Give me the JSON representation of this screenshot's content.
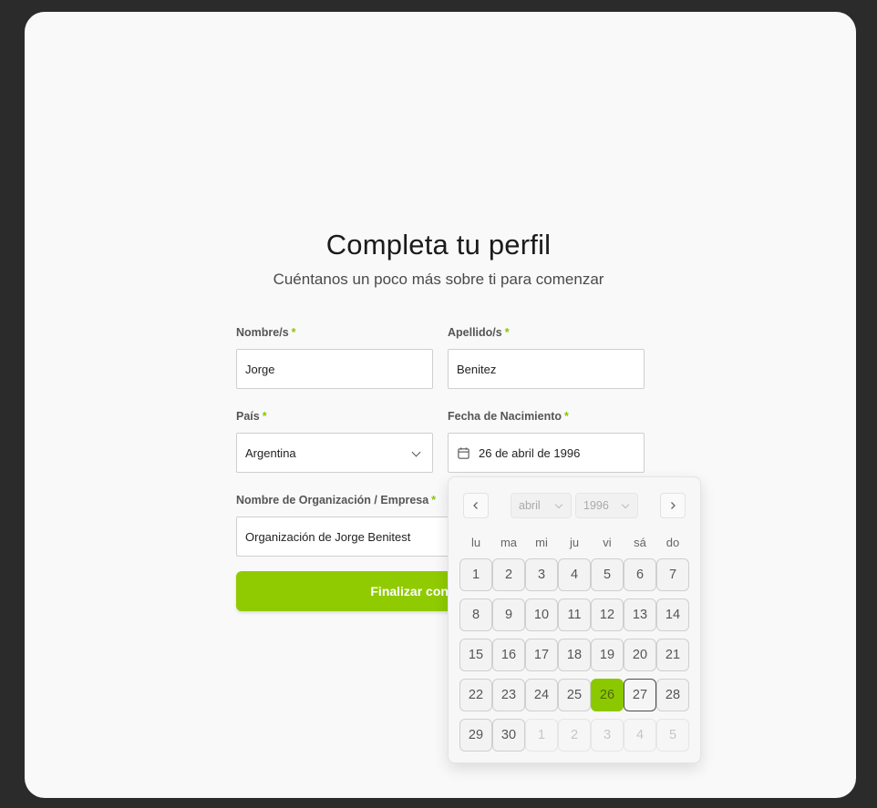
{
  "header": {
    "title": "Completa tu perfil",
    "subtitle": "Cuéntanos un poco más sobre ti para comenzar"
  },
  "form": {
    "required_mark": "*",
    "first_name": {
      "label": "Nombre/s",
      "value": "Jorge"
    },
    "last_name": {
      "label": "Apellido/s",
      "value": "Benitez"
    },
    "country": {
      "label": "País",
      "value": "Argentina"
    },
    "birth_date": {
      "label": "Fecha de Nacimiento",
      "value": "26 de abril de 1996"
    },
    "organization": {
      "label": "Nombre de Organización / Empresa",
      "value": "Organización de Jorge Benitest"
    },
    "submit_label": "Finalizar configuración"
  },
  "calendar": {
    "month": "abril",
    "year": "1996",
    "weekdays": [
      "lu",
      "ma",
      "mi",
      "ju",
      "vi",
      "sá",
      "do"
    ],
    "weeks": [
      [
        "1",
        "2",
        "3",
        "4",
        "5",
        "6",
        "7"
      ],
      [
        "8",
        "9",
        "10",
        "11",
        "12",
        "13",
        "14"
      ],
      [
        "15",
        "16",
        "17",
        "18",
        "19",
        "20",
        "21"
      ],
      [
        "22",
        "23",
        "24",
        "25",
        "26",
        "27",
        "28"
      ],
      [
        "29",
        "30",
        "1",
        "2",
        "3",
        "4",
        "5"
      ]
    ],
    "selected_day": "26",
    "today_day": "27",
    "accent_color": "#8cc800"
  },
  "colors": {
    "accent": "#8fcb00",
    "background": "#2b2b2b",
    "card": "#f9f9f9"
  }
}
